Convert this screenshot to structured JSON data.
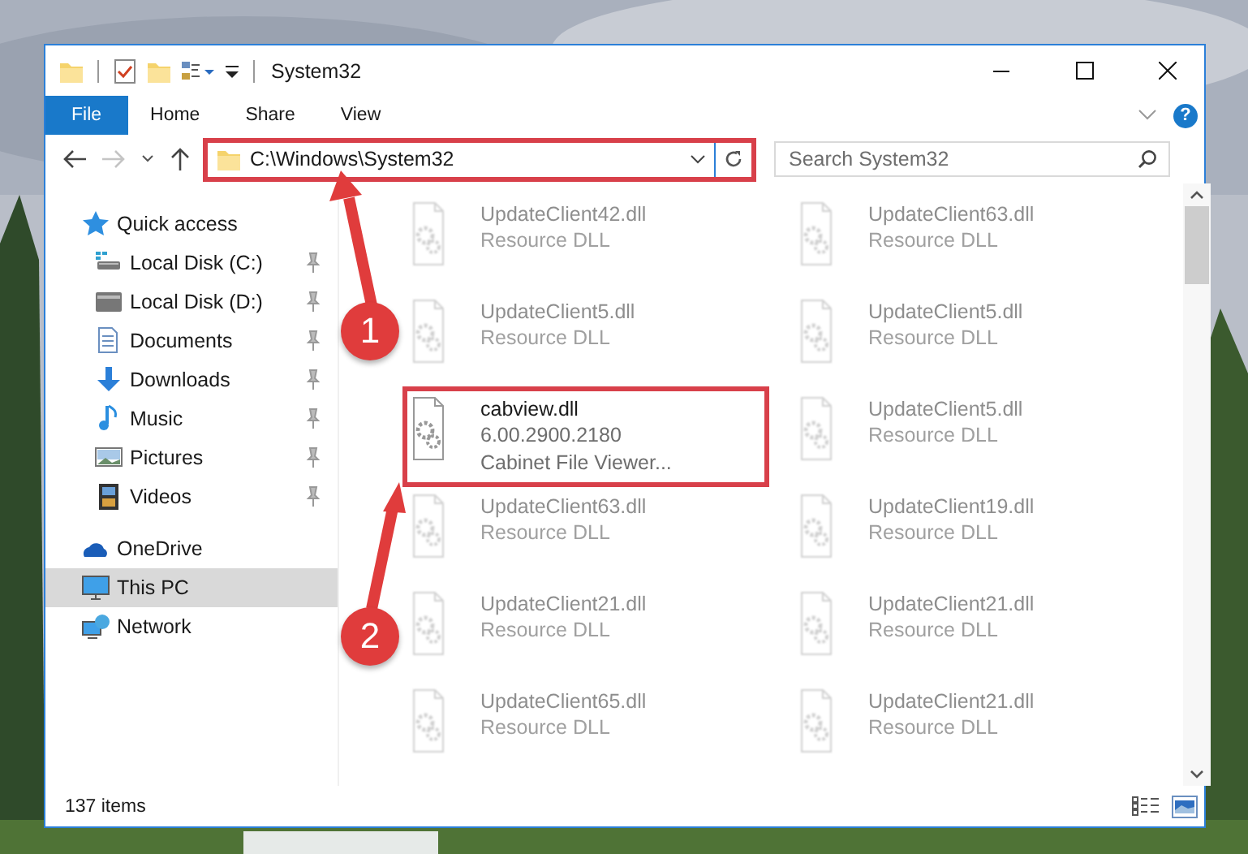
{
  "window": {
    "title": "System32"
  },
  "ribbon": {
    "tabs": [
      {
        "label": "File",
        "selected": true
      },
      {
        "label": "Home",
        "selected": false
      },
      {
        "label": "Share",
        "selected": false
      },
      {
        "label": "View",
        "selected": false
      }
    ],
    "help": "?"
  },
  "navigation": {
    "forward_disabled": true
  },
  "address": {
    "path": "C:\\Windows\\System32",
    "highlighted": true
  },
  "search": {
    "placeholder": "Search System32"
  },
  "sidebar": {
    "items": [
      {
        "label": "Quick access",
        "selected": false,
        "children": [
          {
            "label": "Local Disk (C:)",
            "pinned": true
          },
          {
            "label": "Local Disk (D:)",
            "pinned": true
          },
          {
            "label": "Documents",
            "pinned": true
          },
          {
            "label": "Downloads",
            "pinned": true
          },
          {
            "label": "Music",
            "pinned": true
          },
          {
            "label": "Pictures",
            "pinned": true
          },
          {
            "label": "Videos",
            "pinned": true
          }
        ]
      },
      {
        "label": "OneDrive",
        "selected": false
      },
      {
        "label": "This PC",
        "selected": true
      },
      {
        "label": "Network",
        "selected": false
      }
    ]
  },
  "files": [
    {
      "lines": [
        "UpdateClient42.dll",
        "Resource DLL"
      ],
      "blurred": true,
      "highlighted": false
    },
    {
      "lines": [
        "UpdateClient63.dll",
        "Resource DLL"
      ],
      "blurred": true,
      "highlighted": false
    },
    {
      "lines": [
        "UpdateClient5.dll",
        "Resource DLL"
      ],
      "blurred": true,
      "highlighted": false
    },
    {
      "lines": [
        "UpdateClient5.dll",
        "Resource DLL"
      ],
      "blurred": true,
      "highlighted": false
    },
    {
      "lines": [
        "cabview.dll",
        "6.00.2900.2180",
        "Cabinet File Viewer..."
      ],
      "blurred": false,
      "highlighted": true
    },
    {
      "lines": [
        "UpdateClient5.dll",
        "Resource DLL"
      ],
      "blurred": true,
      "highlighted": false
    },
    {
      "lines": [
        "UpdateClient63.dll",
        "Resource DLL"
      ],
      "blurred": true,
      "highlighted": false
    },
    {
      "lines": [
        "UpdateClient19.dll",
        "Resource DLL"
      ],
      "blurred": true,
      "highlighted": false
    },
    {
      "lines": [
        "UpdateClient21.dll",
        "Resource DLL"
      ],
      "blurred": true,
      "highlighted": false
    },
    {
      "lines": [
        "UpdateClient21.dll",
        "Resource DLL"
      ],
      "blurred": true,
      "highlighted": false
    },
    {
      "lines": [
        "UpdateClient65.dll",
        "Resource DLL"
      ],
      "blurred": true,
      "highlighted": false
    },
    {
      "lines": [
        "UpdateClient21.dll",
        "Resource DLL"
      ],
      "blurred": true,
      "highlighted": false
    }
  ],
  "status_bar": {
    "count": "137 items"
  },
  "annotations": [
    {
      "label": "1"
    },
    {
      "label": "2"
    }
  ]
}
